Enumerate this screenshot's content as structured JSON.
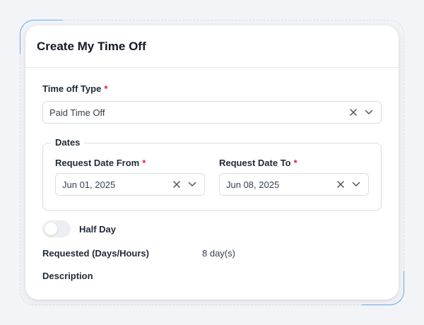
{
  "form": {
    "title": "Create My Time Off",
    "time_off_type": {
      "label": "Time off Type",
      "required_mark": "*",
      "value": "Paid Time Off"
    },
    "dates": {
      "legend": "Dates",
      "from": {
        "label": "Request Date From",
        "required_mark": "*",
        "value": "Jun 01, 2025"
      },
      "to": {
        "label": "Request Date To",
        "required_mark": "*",
        "value": "Jun 08, 2025"
      }
    },
    "half_day": {
      "label": "Half Day",
      "enabled": false
    },
    "requested": {
      "label": "Requested (Days/Hours)",
      "value": "8 day(s)"
    },
    "description": {
      "label": "Description"
    }
  },
  "colors": {
    "accent": "#6aa9e8",
    "required": "#e11d48",
    "border": "#d9dce3"
  },
  "icons": {
    "clear": "close-icon",
    "dropdown": "chevron-down-icon"
  }
}
